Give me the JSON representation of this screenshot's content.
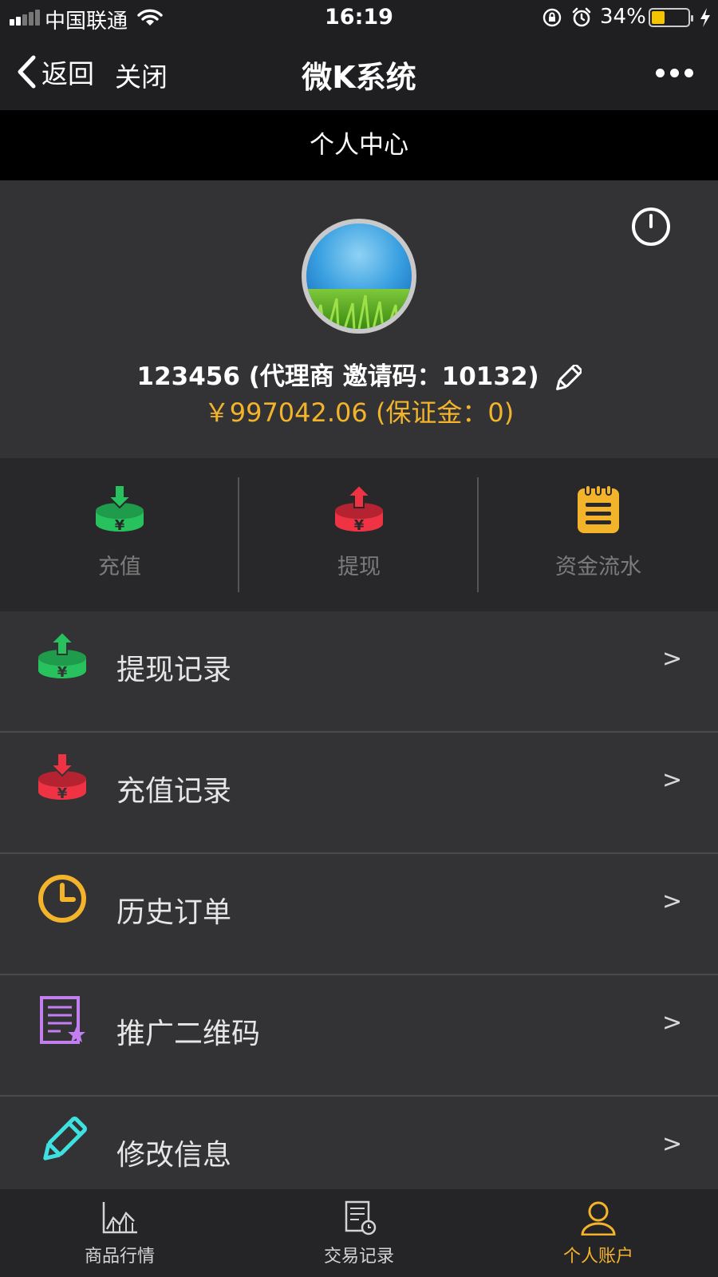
{
  "status_bar": {
    "carrier": "中国联通",
    "time": "16:19",
    "battery": "34%",
    "battery_level": 0.34
  },
  "nav": {
    "back_label": "返回",
    "close_label": "关闭",
    "title": "微K系统"
  },
  "page_header": "个人中心",
  "profile": {
    "user_line": "123456 (代理商 邀请码：10132)",
    "balance_line": "￥997042.06 (保证金：0)"
  },
  "actions": [
    {
      "label": "充值",
      "icon": "deposit-icon",
      "color": "#27c25e"
    },
    {
      "label": "提现",
      "icon": "withdraw-icon",
      "color": "#ef3344"
    },
    {
      "label": "资金流水",
      "icon": "notepad-icon",
      "color": "#f3b42c"
    }
  ],
  "menu": [
    {
      "label": "提现记录",
      "icon": "withdraw-record-icon",
      "color": "#27c25e",
      "chevron": ">"
    },
    {
      "label": "充值记录",
      "icon": "deposit-record-icon",
      "color": "#ef3344",
      "chevron": ">"
    },
    {
      "label": "历史订单",
      "icon": "clock-icon",
      "color": "#f3b42c",
      "chevron": ">"
    },
    {
      "label": "推广二维码",
      "icon": "document-star-icon",
      "color": "#c37ff0",
      "chevron": ">"
    },
    {
      "label": "修改信息",
      "icon": "pencil-icon",
      "color": "#3fe0e0",
      "chevron": ">"
    }
  ],
  "tabs": [
    {
      "label": "商品行情",
      "icon": "chart-icon"
    },
    {
      "label": "交易记录",
      "icon": "receipt-icon"
    },
    {
      "label": "个人账户",
      "icon": "person-icon",
      "active": true
    }
  ]
}
